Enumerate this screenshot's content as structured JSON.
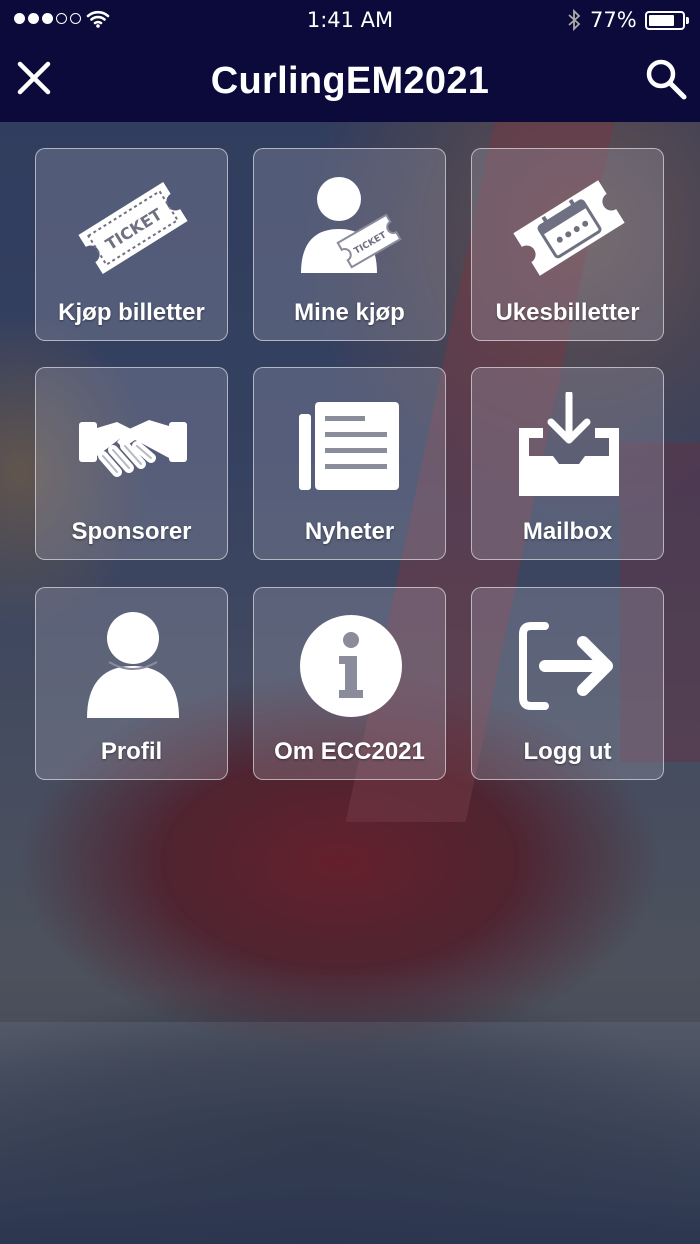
{
  "status_bar": {
    "time": "1:41 AM",
    "battery_percent": "77%",
    "battery_level": 0.77,
    "signal_bars": 3,
    "signal_total": 5,
    "icons": [
      "signal-dots-icon",
      "wifi-icon",
      "bluetooth-icon",
      "battery-icon"
    ]
  },
  "nav": {
    "title": "CurlingEM2021",
    "left_icon": "close-icon",
    "right_icon": "search-icon"
  },
  "menu": {
    "items": [
      {
        "label": "Kjøp billetter",
        "icon": "ticket-icon"
      },
      {
        "label": "Mine kjøp",
        "icon": "user-ticket-icon"
      },
      {
        "label": "Ukesbilletter",
        "icon": "calendar-ticket-icon"
      },
      {
        "label": "Sponsorer",
        "icon": "handshake-icon"
      },
      {
        "label": "Nyheter",
        "icon": "newspaper-icon"
      },
      {
        "label": "Mailbox",
        "icon": "inbox-download-icon"
      },
      {
        "label": "Profil",
        "icon": "user-icon"
      },
      {
        "label": "Om ECC2021",
        "icon": "info-icon"
      },
      {
        "label": "Logg ut",
        "icon": "logout-icon"
      }
    ]
  },
  "colors": {
    "nav_background": "#0b0a3a",
    "tile_border": "#ffffff",
    "text": "#ffffff"
  }
}
